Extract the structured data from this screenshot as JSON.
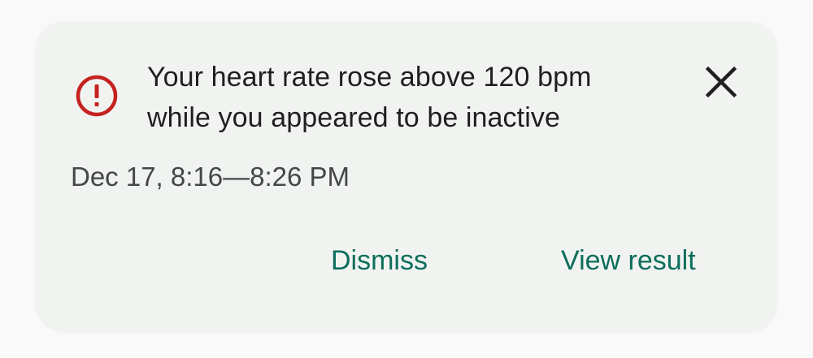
{
  "notification": {
    "icon": "error-alert-icon",
    "icon_color": "#c5221f",
    "title_line1": "Your heart rate rose above 120 bpm",
    "title_line2": "while you appeared to be inactive",
    "close_icon": "close-icon",
    "timestamp": "Dec 17, 8:16—8:26 PM",
    "actions": {
      "dismiss_label": "Dismiss",
      "view_result_label": "View result"
    },
    "accent_color": "#0d6e5c",
    "card_background": "#f1f3f1"
  }
}
